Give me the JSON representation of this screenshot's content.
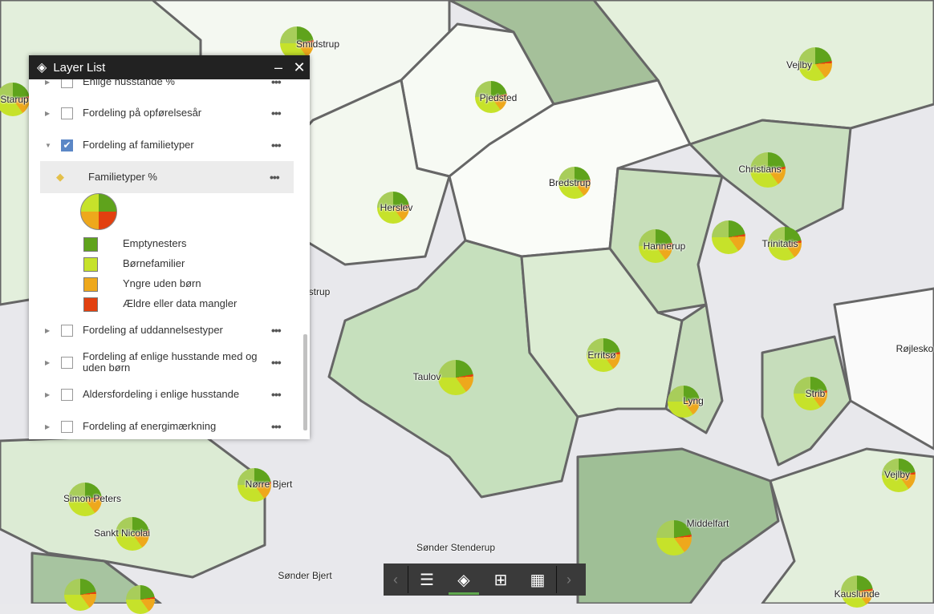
{
  "panel": {
    "title": "Layer List",
    "minimize": "–",
    "close": "✕",
    "layers": [
      {
        "label": "Enlige husstande %",
        "checked": false
      },
      {
        "label": "Fordeling på opførelsesår",
        "checked": false
      },
      {
        "label": "Fordeling af familietyper",
        "checked": true,
        "expanded": true
      },
      {
        "label": "Familietyper %",
        "sublayer": true
      },
      {
        "label": "Fordeling af uddannelsestyper",
        "checked": false
      },
      {
        "label": "Fordeling af enlige husstande med og uden børn",
        "checked": false
      },
      {
        "label": "Aldersfordeling i enlige husstande",
        "checked": false
      },
      {
        "label": "Fordeling af energimærkning",
        "checked": false
      }
    ],
    "legend": [
      {
        "label": "Emptynesters",
        "color": "#5fa31c"
      },
      {
        "label": "Børnefamilier",
        "color": "#c6e22a"
      },
      {
        "label": "Yngre uden børn",
        "color": "#eea81c"
      },
      {
        "label": "Ældre eller data mangler",
        "color": "#e2400f"
      }
    ],
    "more": "•••"
  },
  "toolbar": {
    "icons": [
      "list-icon",
      "layers-icon",
      "calculator-icon",
      "grid-icon"
    ],
    "active": "layers-icon"
  },
  "places": [
    "Smidstrup",
    "Vejlby",
    "Starup",
    "Pjedsted",
    "Christians",
    "Bredstrup",
    "Herslev",
    "Hannerup",
    "Trinitatis",
    "Taulov",
    "Erritsø",
    "Lyng",
    "Strib",
    "Røjlesko",
    "Nørre Bjert",
    "Simon Peters",
    "Sankt Nicolai",
    "Sønder Stenderup",
    "Middelfart",
    "Sønder Bjert",
    "Vejlby",
    "Kauslunde",
    "strup"
  ]
}
